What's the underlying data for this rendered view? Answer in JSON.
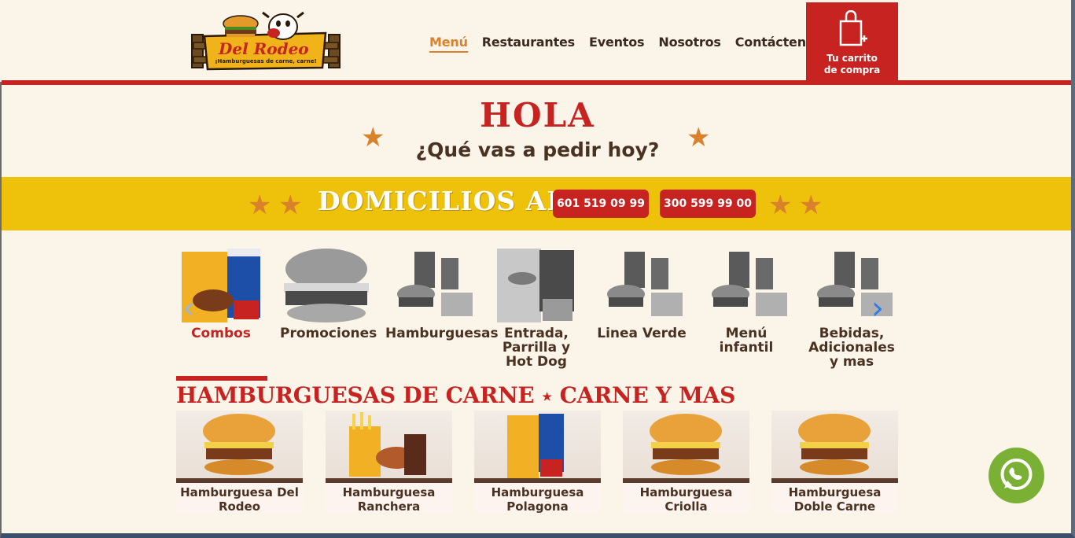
{
  "header": {
    "logo_text": "Del Rodeo",
    "logo_tagline": "¡Hamburguesas de carne, carne!",
    "nav": [
      "Menú",
      "Restaurantes",
      "Eventos",
      "Nosotros",
      "Contáctenos"
    ],
    "active_nav": "Menú",
    "cart_label_line1": "Tu carrito",
    "cart_label_line2": "de compra"
  },
  "hero": {
    "title": "HOLA",
    "subtitle": "¿Qué vas a pedir hoy?"
  },
  "banner": {
    "text": "DOMICILIOS AL",
    "phones": [
      "601 519 09 99",
      "300 599 99 00"
    ]
  },
  "categories": [
    {
      "label": "Combos",
      "active": true,
      "icon": "combo-image"
    },
    {
      "label": "Promociones",
      "active": false,
      "icon": "burger-image"
    },
    {
      "label": "Hamburguesas",
      "active": false,
      "icon": "burger-combo-image"
    },
    {
      "label": "Entrada, Parrilla y Hot Dog",
      "active": false,
      "icon": "combo-image"
    },
    {
      "label": "Linea Verde",
      "active": false,
      "icon": "burger-combo-image"
    },
    {
      "label": "Menú infantil",
      "active": false,
      "icon": "burger-combo-image"
    },
    {
      "label": "Bebidas, Adicionales y mas",
      "active": false,
      "icon": "burger-combo-image"
    }
  ],
  "section": {
    "title_part1": "HAMBURGUESAS DE CARNE",
    "title_sep": "★",
    "title_part2": "CARNE Y MAS"
  },
  "products": [
    {
      "name": "Hamburguesa Del Rodeo",
      "icon": "burger-image"
    },
    {
      "name": "Hamburguesa Ranchera",
      "icon": "burger-fries-image"
    },
    {
      "name": "Hamburguesa Polagona",
      "icon": "combo-image"
    },
    {
      "name": "Hamburguesa Criolla",
      "icon": "burger-image"
    },
    {
      "name": "Hamburguesa Doble Carne",
      "icon": "burger-image"
    }
  ],
  "colors": {
    "brand_red": "#c62321",
    "accent_orange": "#d9822b",
    "banner_yellow": "#eec20a",
    "background": "#fbf4e8",
    "whatsapp_green": "#7ab135"
  }
}
